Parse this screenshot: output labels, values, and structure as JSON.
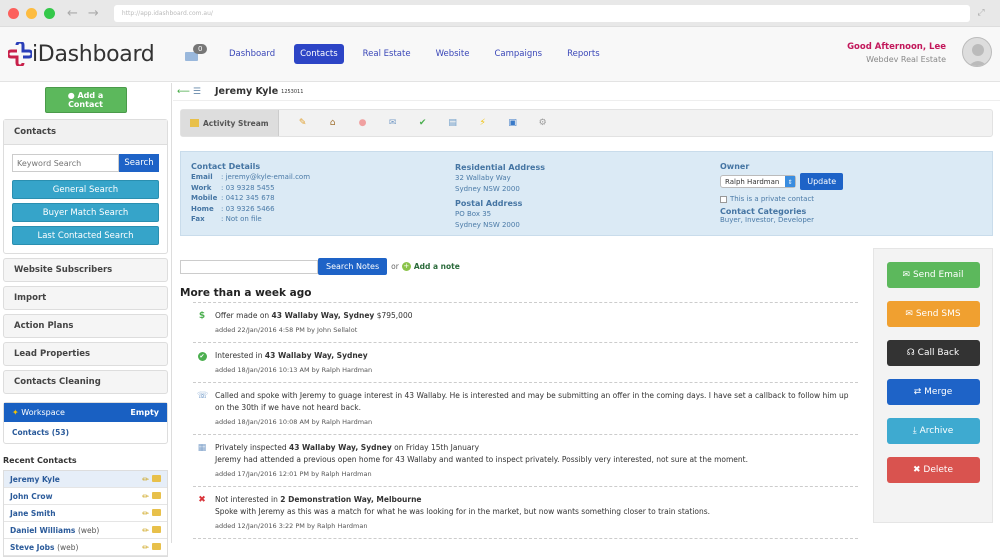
{
  "browser": {
    "url": "http://app.idashboard.com.au/"
  },
  "header": {
    "brand": "iDashboard",
    "mail_count": "0",
    "nav": [
      {
        "label": "Dashboard",
        "active": false
      },
      {
        "label": "Contacts",
        "active": true
      },
      {
        "label": "Real Estate",
        "active": false
      },
      {
        "label": "Website",
        "active": false
      },
      {
        "label": "Campaigns",
        "active": false
      },
      {
        "label": "Reports",
        "active": false
      }
    ],
    "greeting": "Good Afternoon, Lee",
    "company": "Webdev Real Estate"
  },
  "sidebar": {
    "add_contact": "Add a Contact",
    "contacts_title": "Contacts",
    "keyword_placeholder": "Keyword Search",
    "search_label": "Search",
    "search_buttons": [
      "General Search",
      "Buyer Match Search",
      "Last Contacted Search"
    ],
    "items": [
      "Website Subscribers",
      "Import",
      "Action Plans",
      "Lead Properties",
      "Contacts Cleaning"
    ],
    "workspace": {
      "title": "Workspace",
      "status": "Empty",
      "link": "Contacts (53)"
    },
    "recent_title": "Recent Contacts",
    "recent": [
      {
        "name": "Jeremy Kyle",
        "tag": ""
      },
      {
        "name": "John Crow",
        "tag": ""
      },
      {
        "name": "Jane Smith",
        "tag": ""
      },
      {
        "name": "Daniel Williams",
        "tag": "(web)"
      },
      {
        "name": "Steve Jobs",
        "tag": "(web)"
      }
    ]
  },
  "contact": {
    "name": "Jeremy Kyle",
    "id": "1253011",
    "tab_active": "Activity Stream",
    "details_title": "Contact Details",
    "details": [
      {
        "k": "Email",
        "v": ": jeremy@kyle-email.com"
      },
      {
        "k": "Work",
        "v": ": 03 9328 5455"
      },
      {
        "k": "Mobile",
        "v": ": 0412 345 678"
      },
      {
        "k": "Home",
        "v": ": 03 9326 5466"
      },
      {
        "k": "Fax",
        "v": ": Not on file"
      }
    ],
    "residential_title": "Residential Address",
    "residential": [
      "32 Wallaby Way",
      "Sydney NSW 2000"
    ],
    "postal_title": "Postal Address",
    "postal": [
      "PO Box 35",
      "Sydney NSW 2000"
    ],
    "owner_title": "Owner",
    "owner": "Ralph Hardman",
    "update": "Update",
    "private_label": "This is a private contact",
    "categories_title": "Contact Categories",
    "categories": "Buyer, Investor, Developer"
  },
  "notes": {
    "search_label": "Search Notes",
    "or": "or",
    "add_label": "Add a note",
    "section": "More than a week ago"
  },
  "feed": [
    {
      "icon": "dollar",
      "pre": "Offer made on ",
      "bold": "43 Wallaby Way, Sydney",
      "post": " $795,000",
      "body": "",
      "meta": "added 22/Jan/2016 4:58 PM by John Sellalot"
    },
    {
      "icon": "check",
      "pre": "Interested in ",
      "bold": "43 Wallaby Way, Sydney",
      "post": "",
      "body": "",
      "meta": "added 18/Jan/2016 10:13 AM by Ralph Hardman"
    },
    {
      "icon": "phone-note",
      "pre": "Called and spoke with Jeremy to guage interest in 43 Wallaby. He is interested and may be submitting an offer in the coming days. I have set a callback to follow him up on the 30th if we have not heard back.",
      "bold": "",
      "post": "",
      "body": "",
      "meta": "added 18/Jan/2016 10:08 AM by Ralph Hardman"
    },
    {
      "icon": "calendar",
      "pre": "Privately inspected ",
      "bold": "43 Wallaby Way, Sydney",
      "post": " on Friday 15th January",
      "body": "Jeremy had attended a previous open home for 43 Wallaby and wanted to inspect privately. Possibly very interested, not sure at the moment.",
      "meta": "added 17/Jan/2016 12:01 PM by Ralph Hardman"
    },
    {
      "icon": "cross",
      "pre": "Not interested in ",
      "bold": "2 Demonstration Way, Melbourne",
      "post": "",
      "body": "Spoke with Jeremy as this was a match for what he was looking for in the market, but now wants something closer to train stations.",
      "meta": "added 12/Jan/2016 3:22 PM by Ralph Hardman"
    }
  ],
  "actions": [
    {
      "label": "Send Email",
      "icon": "envelope",
      "color": "#5cb85c"
    },
    {
      "label": "Send SMS",
      "icon": "envelope",
      "color": "#f0a030"
    },
    {
      "label": "Call Back",
      "icon": "headphones",
      "color": "#333333"
    },
    {
      "label": "Merge",
      "icon": "retweet",
      "color": "#1e63c7"
    },
    {
      "label": "Archive",
      "icon": "download",
      "color": "#3eaad0"
    },
    {
      "label": "Delete",
      "icon": "x",
      "color": "#d9534f"
    }
  ]
}
